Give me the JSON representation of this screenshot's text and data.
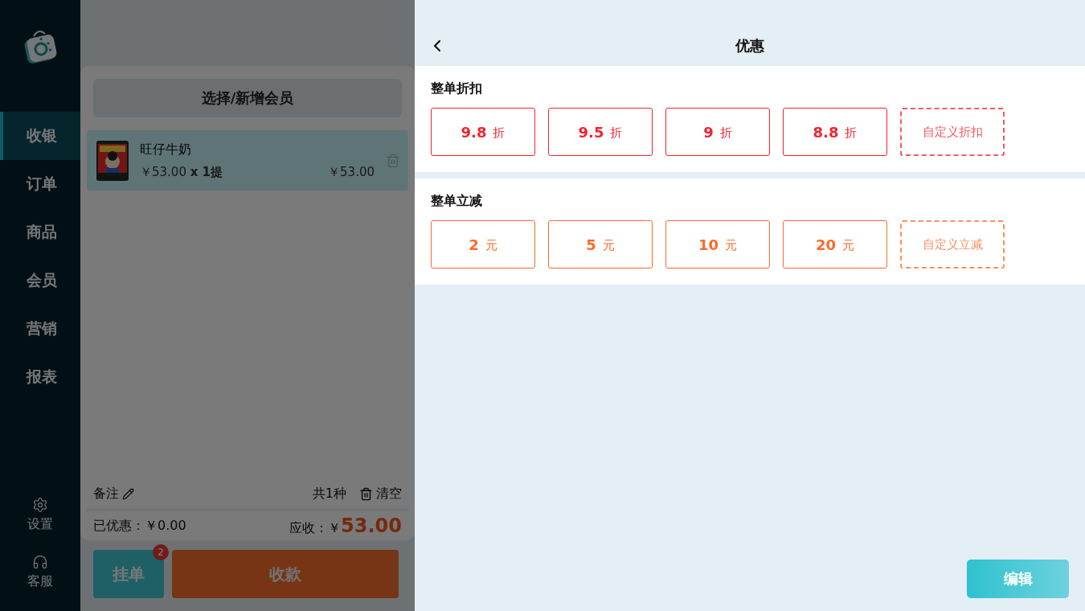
{
  "sidebar": {
    "items": [
      {
        "label": "收银",
        "selected": true
      },
      {
        "label": "订单",
        "selected": false
      },
      {
        "label": "商品",
        "selected": false
      },
      {
        "label": "会员",
        "selected": false
      },
      {
        "label": "营销",
        "selected": false
      },
      {
        "label": "报表",
        "selected": false
      }
    ],
    "bottom_items": [
      {
        "kind": "settings",
        "label": "设置"
      },
      {
        "kind": "support",
        "label": "客服"
      }
    ]
  },
  "cart": {
    "member_button": "选择/新增会员",
    "items": [
      {
        "name": "旺仔牛奶",
        "price_line": "￥53.00 **x 1提**",
        "total": "￥53.00"
      }
    ],
    "note_label": "备注",
    "count": "共1种",
    "clear": "清空",
    "discount_label": "已优惠：￥0.00",
    "due_label": "应收：￥",
    "due_amount": "53.00",
    "hold_button": "挂单",
    "hold_badge": "2",
    "pay_button": "收款"
  },
  "panel": {
    "title": "优惠",
    "sections": [
      {
        "title": "整单折扣",
        "color": "#f5222d",
        "options": [
          {
            "kind": "preset",
            "value": "9.8",
            "unit": "折"
          },
          {
            "kind": "preset",
            "value": "9.5",
            "unit": "折"
          },
          {
            "kind": "preset",
            "value": "9",
            "unit": "折"
          },
          {
            "kind": "preset",
            "value": "8.8",
            "unit": "折"
          },
          {
            "kind": "custom",
            "label": "自定义折扣"
          }
        ]
      },
      {
        "title": "整单立减",
        "color": "#ff6a28",
        "options": [
          {
            "kind": "preset",
            "value": "2",
            "unit": "元"
          },
          {
            "kind": "preset",
            "value": "5",
            "unit": "元"
          },
          {
            "kind": "preset",
            "value": "10",
            "unit": "元"
          },
          {
            "kind": "preset",
            "value": "20",
            "unit": "元"
          },
          {
            "kind": "custom",
            "label": "自定义立减"
          }
        ]
      }
    ],
    "edit_button": "编辑"
  }
}
